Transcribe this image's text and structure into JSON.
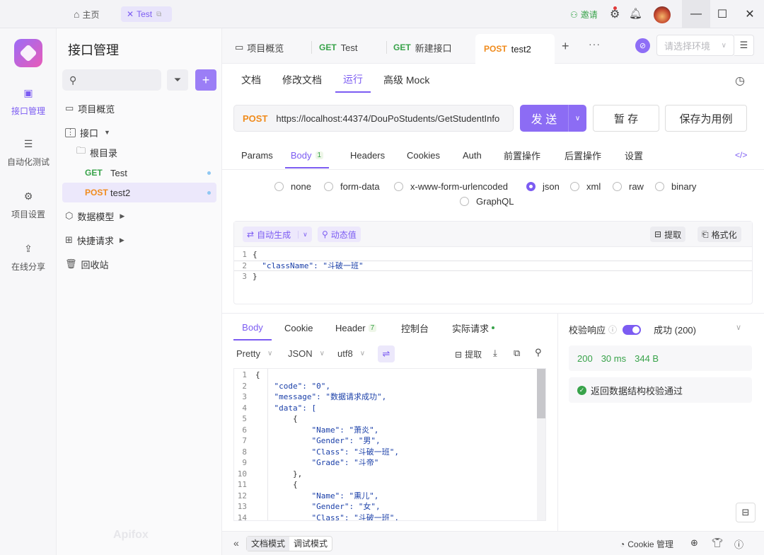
{
  "titlebar": {
    "home_label": "主页",
    "project_tab": "Test",
    "invite_label": "邀请"
  },
  "rail": {
    "items": [
      {
        "label": "接口管理"
      },
      {
        "label": "自动化测试"
      },
      {
        "label": "项目设置"
      },
      {
        "label": "在线分享"
      }
    ],
    "brand": "Apifox"
  },
  "sidebar": {
    "title": "接口管理",
    "tree": {
      "overview": "项目概览",
      "apis": "接口",
      "root": "根目录",
      "items": [
        {
          "method": "GET",
          "name": "Test"
        },
        {
          "method": "POST",
          "name": "test2"
        }
      ],
      "models": "数据模型",
      "quick": "快捷请求",
      "trash": "回收站"
    }
  },
  "tabs": [
    {
      "method": "",
      "label": "项目概览"
    },
    {
      "method": "GET",
      "label": "Test"
    },
    {
      "method": "GET",
      "label": "新建接口"
    },
    {
      "method": "POST",
      "label": "test2"
    }
  ],
  "env_placeholder": "请选择环境",
  "subtabs": [
    "文档",
    "修改文档",
    "运行",
    "高级 Mock"
  ],
  "request": {
    "method": "POST",
    "url": "https://localhost:44374/DouPoStudents/GetStudentInfo",
    "send": "发 送",
    "save": "暂 存",
    "save_case": "保存为用例"
  },
  "param_tabs": [
    {
      "label": "Params"
    },
    {
      "label": "Body",
      "count": "1"
    },
    {
      "label": "Headers"
    },
    {
      "label": "Cookies"
    },
    {
      "label": "Auth"
    },
    {
      "label": "前置操作"
    },
    {
      "label": "后置操作"
    },
    {
      "label": "设置"
    }
  ],
  "body_types": [
    "none",
    "form-data",
    "x-www-form-urlencoded",
    "json",
    "xml",
    "raw",
    "binary",
    "GraphQL"
  ],
  "editor_toolbar": {
    "auto_gen": "自动生成",
    "dynamic": "动态值",
    "extract": "提取",
    "format": "格式化"
  },
  "request_body": [
    "{",
    "  \"className\": \"斗破一班\"",
    "}"
  ],
  "response_tabs": [
    {
      "label": "Body"
    },
    {
      "label": "Cookie"
    },
    {
      "label": "Header",
      "count": "7"
    },
    {
      "label": "控制台"
    },
    {
      "label": "实际请求"
    }
  ],
  "response_toolbar": {
    "pretty": "Pretty",
    "format": "JSON",
    "encoding": "utf8",
    "extract": "提取"
  },
  "response_body": [
    "{",
    "    \"code\": \"0\",",
    "    \"message\": \"数据请求成功\",",
    "    \"data\": [",
    "        {",
    "            \"Name\": \"萧炎\",",
    "            \"Gender\": \"男\",",
    "            \"Class\": \"斗破一班\",",
    "            \"Grade\": \"斗帝\"",
    "        },",
    "        {",
    "            \"Name\": \"熏儿\",",
    "            \"Gender\": \"女\",",
    "            \"Class\": \"斗破一班\","
  ],
  "validation": {
    "label": "校验响应",
    "status": "成功 (200)",
    "code": "200",
    "time": "30 ms",
    "size": "344 B",
    "message": "返回数据结构校验通过"
  },
  "footer": {
    "doc_mode": "文档模式",
    "debug_mode": "调试模式",
    "cookie_mgr": "Cookie 管理"
  },
  "colors": {
    "accent": "#7c5cf2",
    "get": "#38a34a",
    "post": "#f08b1c"
  }
}
